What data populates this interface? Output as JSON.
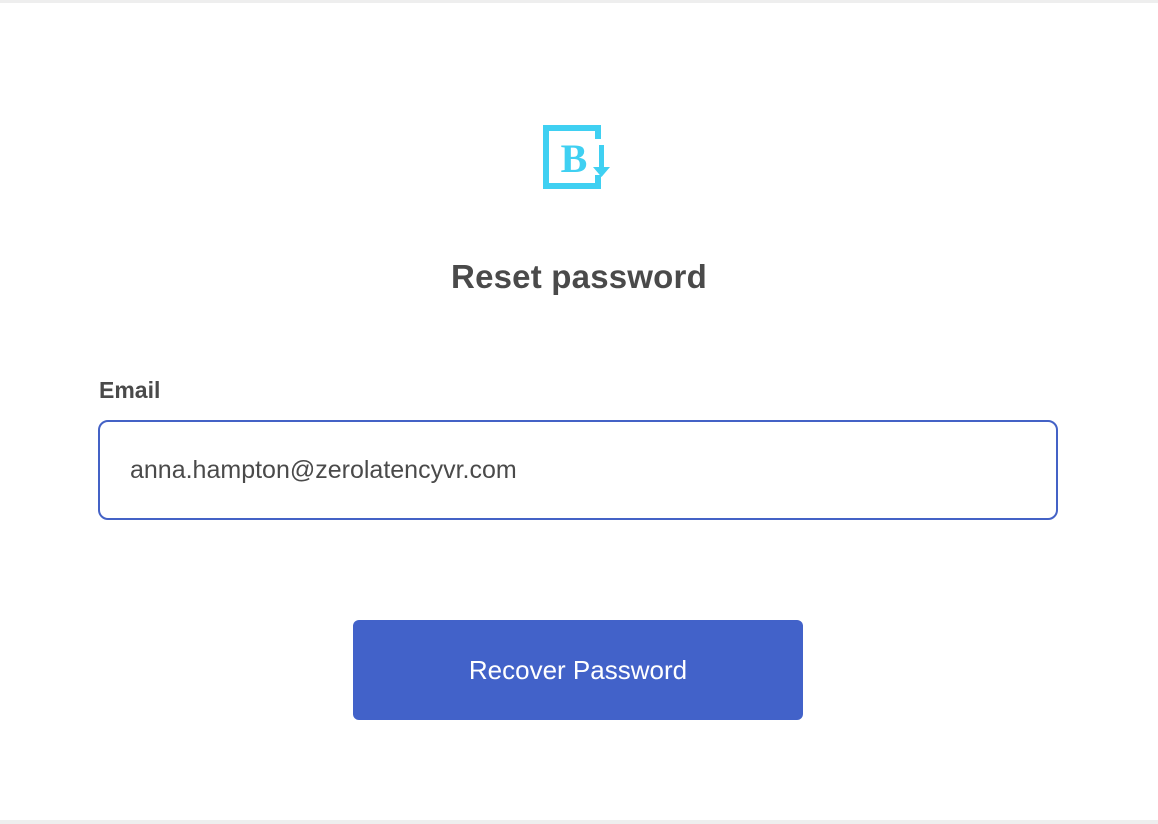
{
  "brand": {
    "logo_icon": "b-download-logo-icon",
    "logo_letter": "B",
    "logo_color": "#3fd0f2"
  },
  "form": {
    "title": "Reset password",
    "email_label": "Email",
    "email_value": "anna.hampton@zerolatencyvr.com",
    "submit_label": "Recover Password"
  },
  "colors": {
    "accent": "#4262c9",
    "input_border": "#4462c6",
    "text": "#4a4a4a",
    "logo": "#3fd0f2"
  }
}
